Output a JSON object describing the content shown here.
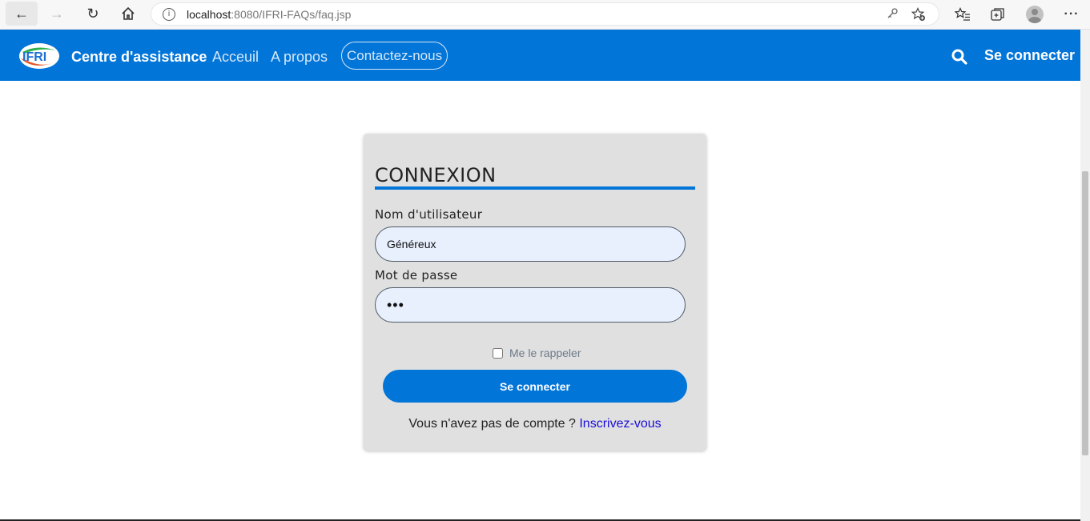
{
  "browser": {
    "url_host": "localhost",
    "url_rest": ":8080/IFRI-FAQs/faq.jsp"
  },
  "navbar": {
    "logo_text": "IFRI",
    "brand": "Centre d'assistance",
    "links": [
      "Acceuil",
      "A propos",
      "Contactez-nous"
    ],
    "login": "Se connecter",
    "color": "#0275d8"
  },
  "login_form": {
    "title": "CONNEXION",
    "username_label": "Nom d'utilisateur",
    "username_value": "Généreux",
    "password_label": "Mot de passe",
    "password_value": "•••",
    "remember_label": "Me le rappeler",
    "submit_label": "Se connecter",
    "signup_prompt": "Vous n'avez pas de compte ? ",
    "signup_link": "Inscrivez-vous"
  }
}
